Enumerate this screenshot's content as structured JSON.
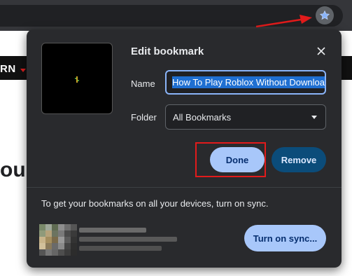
{
  "page_site": {
    "nav_fragment": "RN",
    "heading_fragment": "ou"
  },
  "toolbar": {
    "bookmark_star_icon": "star-icon"
  },
  "bookmark_dialog": {
    "title": "Edit bookmark",
    "close_icon": "close-icon",
    "name_label": "Name",
    "name_value": "How To Play Roblox Without Downloadi",
    "folder_label": "Folder",
    "folder_value": "All Bookmarks",
    "done_label": "Done",
    "remove_label": "Remove",
    "sync_prompt": "To get your bookmarks on all your devices, turn on sync.",
    "sync_button_label": "Turn on sync..."
  },
  "colors": {
    "dialog_bg": "#292a2d",
    "primary_button": "#a8c7fa",
    "remove_button": "#0b4c7a",
    "annotation_red": "#e21b1b"
  }
}
